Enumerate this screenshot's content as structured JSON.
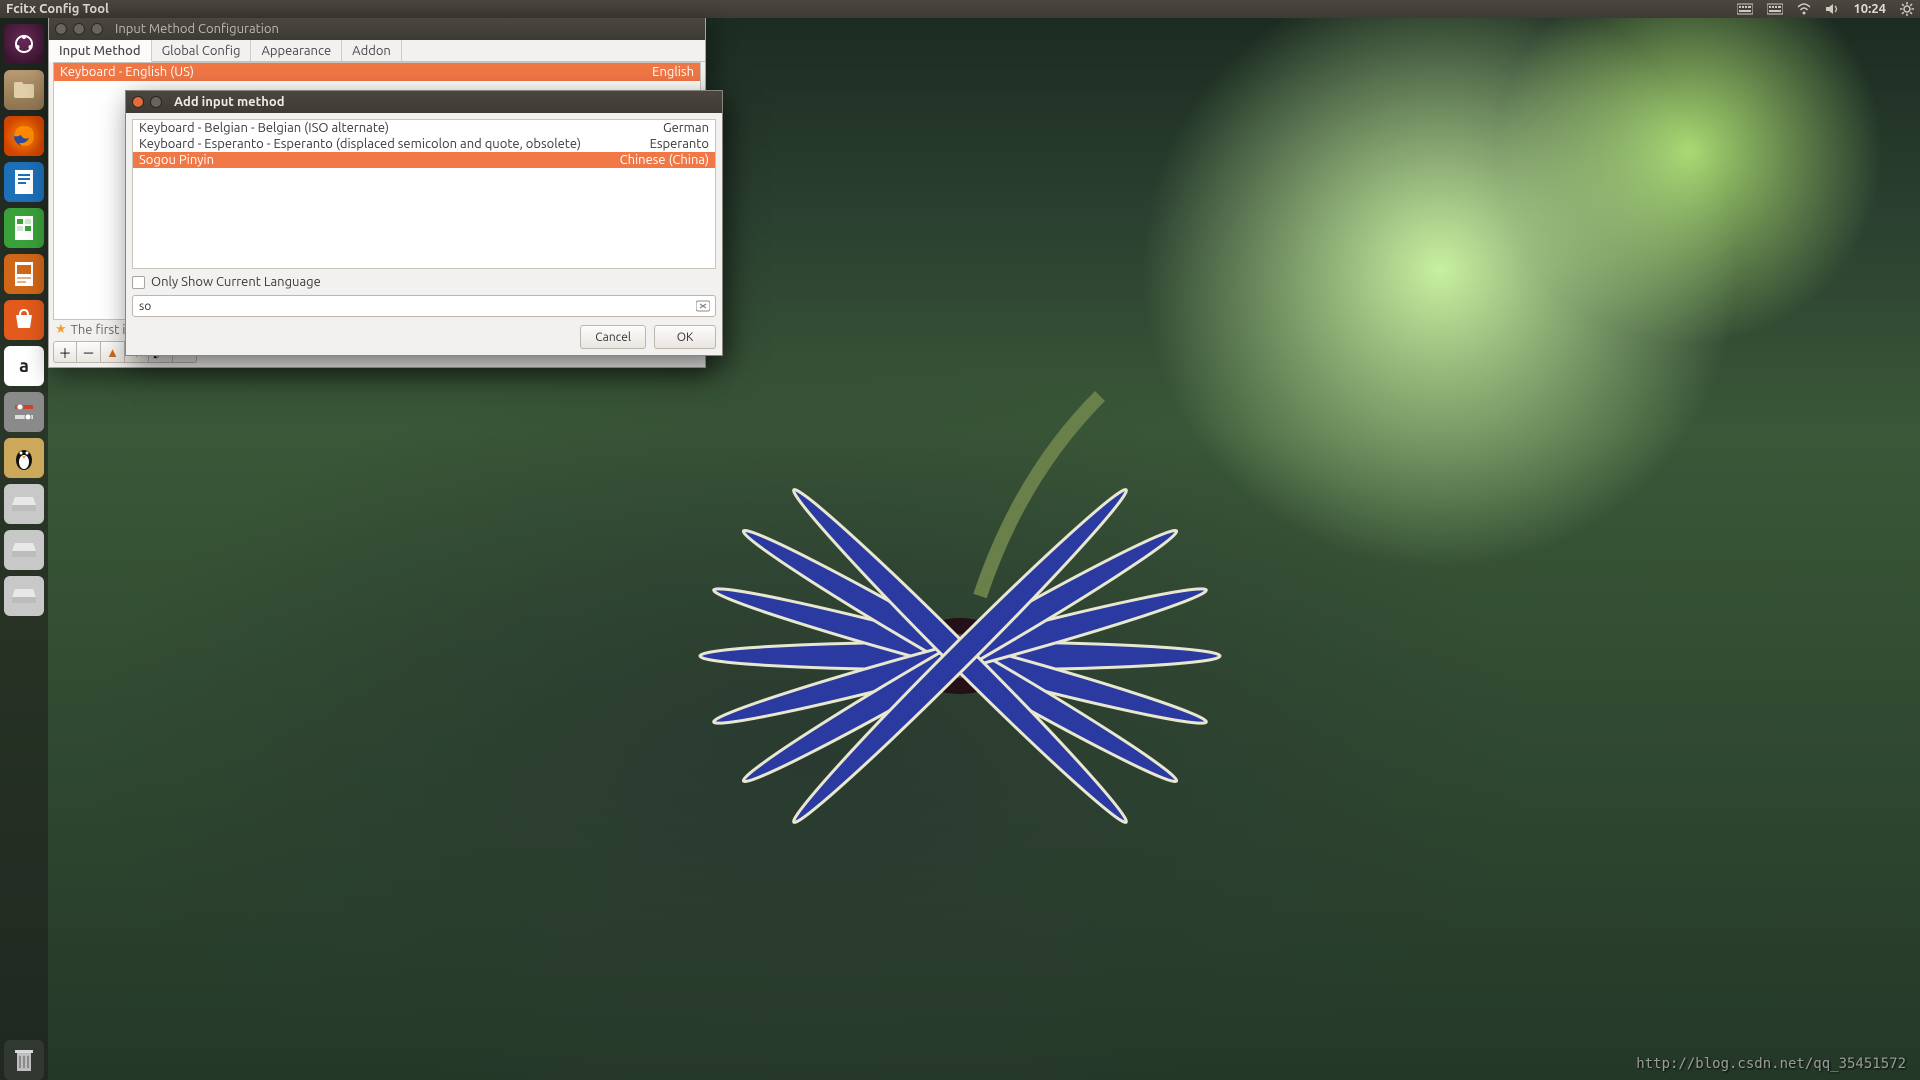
{
  "panel": {
    "app_title": "Fcitx Config Tool",
    "time": "10:24",
    "indicators": [
      "keyboard-icon",
      "keyboard-icon",
      "wifi-icon",
      "sound-icon"
    ]
  },
  "launcher": {
    "items": [
      {
        "name": "dash-icon"
      },
      {
        "name": "files-icon"
      },
      {
        "name": "firefox-icon"
      },
      {
        "name": "writer-icon"
      },
      {
        "name": "calc-icon"
      },
      {
        "name": "impress-icon"
      },
      {
        "name": "software-center-icon"
      },
      {
        "name": "amazon-icon"
      },
      {
        "name": "settings-icon"
      },
      {
        "name": "penguin-icon"
      },
      {
        "name": "drive-icon"
      },
      {
        "name": "drive-icon"
      },
      {
        "name": "drive-icon"
      }
    ],
    "trash": "trash-icon"
  },
  "config_window": {
    "title": "Input Method Configuration",
    "tabs": [
      "Input Method",
      "Global Config",
      "Appearance",
      "Addon"
    ],
    "active_tab": 0,
    "im_list": [
      {
        "name": "Keyboard - English (US)",
        "lang": "English",
        "selected": true
      }
    ],
    "hint": "The first inp",
    "toolbar": [
      "plus-icon",
      "minus-icon",
      "up-icon",
      "down-icon",
      "brush-icon",
      "keyboard-icon"
    ]
  },
  "dialog": {
    "title": "Add input method",
    "list": [
      {
        "name": "Keyboard - Belgian - Belgian (ISO alternate)",
        "lang": "German",
        "selected": false
      },
      {
        "name": "Keyboard - Esperanto - Esperanto (displaced semicolon and quote, obsolete)",
        "lang": "Esperanto",
        "selected": false
      },
      {
        "name": "Sogou Pinyin",
        "lang": "Chinese (China)",
        "selected": true
      }
    ],
    "only_current_label": "Only Show Current Language",
    "only_current_checked": false,
    "search_value": "so",
    "buttons": {
      "cancel": "Cancel",
      "ok": "OK"
    }
  },
  "watermark": "http://blog.csdn.net/qq_35451572",
  "colors": {
    "accent": "#f07746"
  }
}
